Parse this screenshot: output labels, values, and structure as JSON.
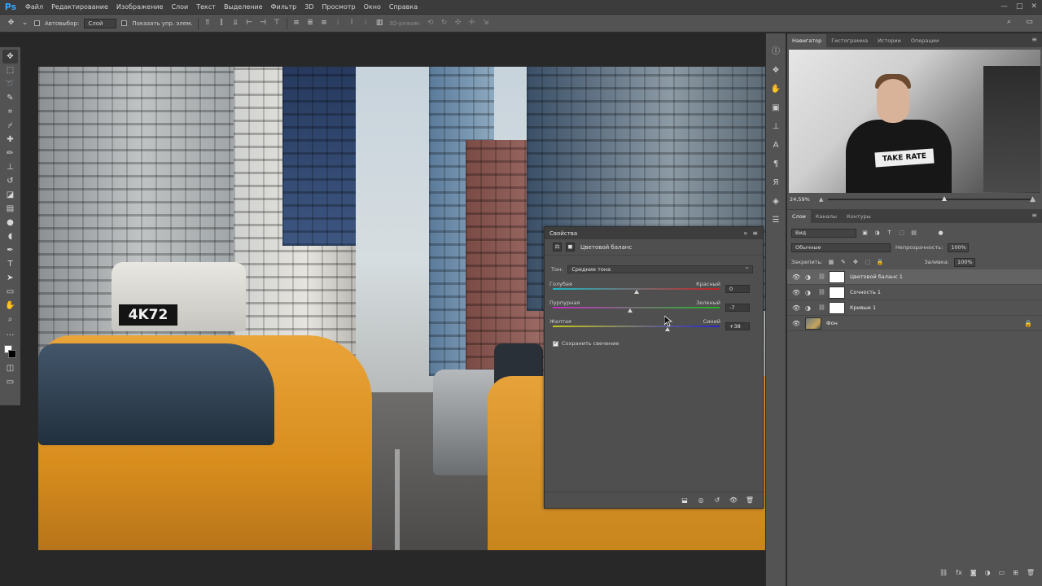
{
  "app": {
    "logo": "Ps"
  },
  "menu": [
    "Файл",
    "Редактирование",
    "Изображение",
    "Слои",
    "Текст",
    "Выделение",
    "Фильтр",
    "3D",
    "Просмотр",
    "Окно",
    "Справка"
  ],
  "window_controls": [
    "—",
    "□",
    "✕"
  ],
  "options": {
    "autoselect_label": "Автовыбор:",
    "autoselect_value": "Слой",
    "show_controls_label": "Показать упр. элем.",
    "mode3d_label": "3D-режим:"
  },
  "canvas": {
    "taxi_plate": "4K72"
  },
  "properties": {
    "title": "Свойства",
    "type_label": "Цветовой баланс",
    "tone_label": "Тон:",
    "tone_value": "Средние тона",
    "sliders": [
      {
        "left": "Голубая",
        "right": "Красный",
        "value": "0",
        "position": 0.5,
        "track": [
          "#1fb6c0",
          "#c42424"
        ]
      },
      {
        "left": "Пурпурная",
        "right": "Зеленый",
        "value": "-7",
        "position": 0.465,
        "track": [
          "#c22fc2",
          "#24b624"
        ]
      },
      {
        "left": "Желтая",
        "right": "Синий",
        "value": "+38",
        "position": 0.69,
        "track": [
          "#c6c61d",
          "#2626c9"
        ]
      }
    ],
    "preserve_label": "Сохранить свечение"
  },
  "navigator": {
    "tabs": [
      "Навигатор",
      "Гистограмма",
      "Истории",
      "Операции"
    ],
    "active_tab": 0,
    "zoom": "24,59%",
    "shirt_text": "TAKE RATE"
  },
  "layers": {
    "tabs": [
      "Слои",
      "Каналы",
      "Контуры"
    ],
    "active_tab": 0,
    "filter_value": "Вид",
    "blend_mode": "Обычные",
    "opacity_label": "Непрозрачность:",
    "opacity_value": "100%",
    "lock_label": "Закрепить:",
    "fill_label": "Заливка:",
    "fill_value": "100%",
    "items": [
      {
        "name": "Цветовой баланс 1",
        "selected": true,
        "type": "adjustment"
      },
      {
        "name": "Сочность 1",
        "selected": false,
        "type": "adjustment"
      },
      {
        "name": "Кривые 1",
        "selected": false,
        "type": "adjustment"
      },
      {
        "name": "Фон",
        "selected": false,
        "type": "photo"
      }
    ]
  }
}
